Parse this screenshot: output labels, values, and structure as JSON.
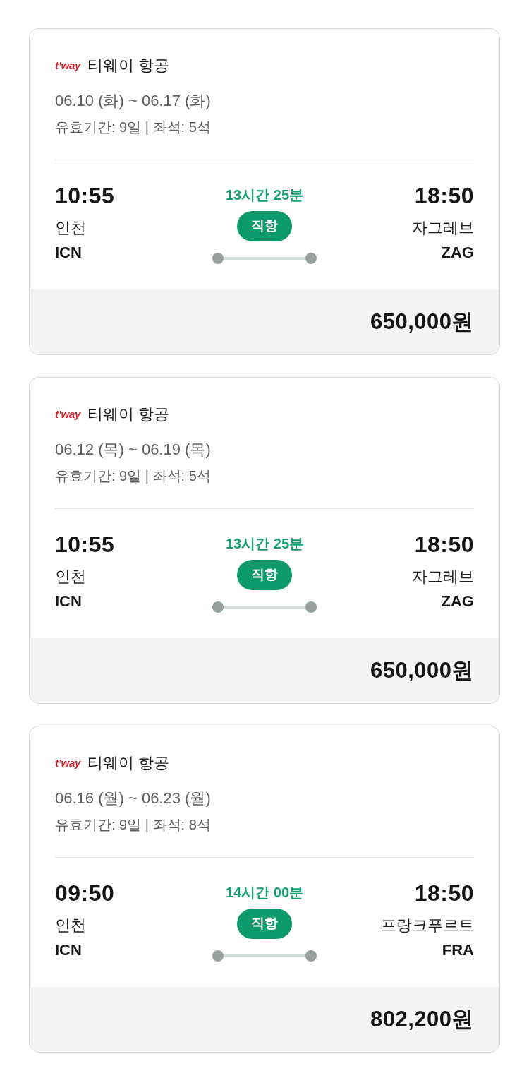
{
  "flights": [
    {
      "airline": {
        "logo": "t’way",
        "name": "티웨이 항공"
      },
      "dates": "06.10 (화) ~ 06.17 (화)",
      "details": "유효기간: 9일 | 좌석: 5석",
      "departure": {
        "time": "10:55",
        "city": "인천",
        "code": "ICN"
      },
      "duration": "13시간 25분",
      "stops": "직항",
      "arrival": {
        "time": "18:50",
        "city": "자그레브",
        "code": "ZAG"
      },
      "price": "650,000원"
    },
    {
      "airline": {
        "logo": "t’way",
        "name": "티웨이 항공"
      },
      "dates": "06.12 (목) ~ 06.19 (목)",
      "details": "유효기간: 9일 | 좌석: 5석",
      "departure": {
        "time": "10:55",
        "city": "인천",
        "code": "ICN"
      },
      "duration": "13시간 25분",
      "stops": "직항",
      "arrival": {
        "time": "18:50",
        "city": "자그레브",
        "code": "ZAG"
      },
      "price": "650,000원"
    },
    {
      "airline": {
        "logo": "t’way",
        "name": "티웨이 항공"
      },
      "dates": "06.16 (월) ~ 06.23 (월)",
      "details": "유효기간: 9일 | 좌석: 8석",
      "departure": {
        "time": "09:50",
        "city": "인천",
        "code": "ICN"
      },
      "duration": "14시간 00분",
      "stops": "직항",
      "arrival": {
        "time": "18:50",
        "city": "프랑크푸르트",
        "code": "FRA"
      },
      "price": "802,200원"
    }
  ]
}
